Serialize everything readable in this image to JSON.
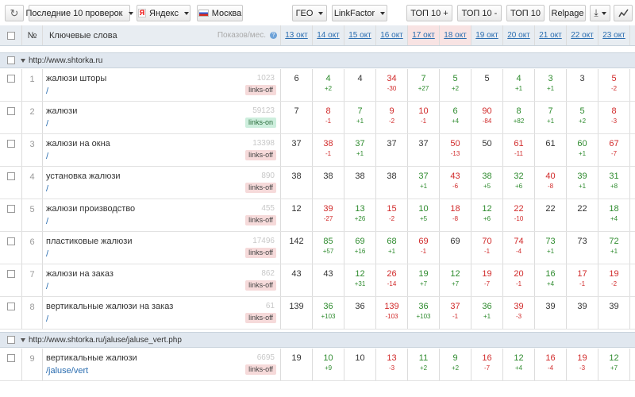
{
  "toolbar": {
    "history_label": "Последние 10 проверок",
    "engine_label": "Яндекс",
    "engine_logo": "Я",
    "region_label": "Москва",
    "geo_label": "ГЕО",
    "linkfactor_label": "LinkFactor",
    "top10plus_label": "ТОП 10 +",
    "top10minus_label": "ТОП 10 -",
    "top10_label": "ТОП 10",
    "relpage_label": "Relpage"
  },
  "table": {
    "col_num": "№",
    "col_keywords": "Ключевые слова",
    "col_shows": "Показов/мес.",
    "dates": [
      "13 окт",
      "14 окт",
      "15 окт",
      "16 окт",
      "17 окт",
      "18 окт",
      "19 окт",
      "20 окт",
      "21 окт",
      "22 окт",
      "23 окт"
    ],
    "highlight_dates": [
      4,
      5
    ]
  },
  "groups": [
    {
      "url": "http://www.shtorka.ru",
      "rows": [
        {
          "n": "1",
          "kw": "жалюзи шторы",
          "sub": "/",
          "shows": "1023",
          "tag": "links-off",
          "pos": [
            [
              "6",
              "",
              "flat"
            ],
            [
              "4",
              "+2",
              "up"
            ],
            [
              "4",
              "",
              "flat"
            ],
            [
              "34",
              "-30",
              "down"
            ],
            [
              "7",
              "+27",
              "up"
            ],
            [
              "5",
              "+2",
              "up"
            ],
            [
              "5",
              "",
              "flat"
            ],
            [
              "4",
              "+1",
              "up"
            ],
            [
              "3",
              "+1",
              "up"
            ],
            [
              "3",
              "",
              "flat"
            ],
            [
              "5",
              "-2",
              "down"
            ]
          ]
        },
        {
          "n": "2",
          "kw": "жалюзи",
          "sub": "/",
          "shows": "59123",
          "tag": "links-on",
          "pos": [
            [
              "7",
              "",
              "flat"
            ],
            [
              "8",
              "-1",
              "down"
            ],
            [
              "7",
              "+1",
              "up"
            ],
            [
              "9",
              "-2",
              "down"
            ],
            [
              "10",
              "-1",
              "down"
            ],
            [
              "6",
              "+4",
              "up"
            ],
            [
              "90",
              "-84",
              "down"
            ],
            [
              "8",
              "+82",
              "up"
            ],
            [
              "7",
              "+1",
              "up"
            ],
            [
              "5",
              "+2",
              "up"
            ],
            [
              "8",
              "-3",
              "down"
            ]
          ]
        },
        {
          "n": "3",
          "kw": "жалюзи на окна",
          "sub": "/",
          "shows": "13398",
          "tag": "links-off",
          "pos": [
            [
              "37",
              "",
              "flat"
            ],
            [
              "38",
              "-1",
              "down"
            ],
            [
              "37",
              "+1",
              "up"
            ],
            [
              "37",
              "",
              "flat"
            ],
            [
              "37",
              "",
              "flat"
            ],
            [
              "50",
              "-13",
              "down"
            ],
            [
              "50",
              "",
              "flat"
            ],
            [
              "61",
              "-11",
              "down"
            ],
            [
              "61",
              "",
              "flat"
            ],
            [
              "60",
              "+1",
              "up"
            ],
            [
              "67",
              "-7",
              "down"
            ]
          ]
        },
        {
          "n": "4",
          "kw": "установка жалюзи",
          "sub": "/",
          "shows": "890",
          "tag": "links-off",
          "pos": [
            [
              "38",
              "",
              "flat"
            ],
            [
              "38",
              "",
              "flat"
            ],
            [
              "38",
              "",
              "flat"
            ],
            [
              "38",
              "",
              "flat"
            ],
            [
              "37",
              "+1",
              "up"
            ],
            [
              "43",
              "-6",
              "down"
            ],
            [
              "38",
              "+5",
              "up"
            ],
            [
              "32",
              "+6",
              "up"
            ],
            [
              "40",
              "-8",
              "down"
            ],
            [
              "39",
              "+1",
              "up"
            ],
            [
              "31",
              "+8",
              "up"
            ]
          ]
        },
        {
          "n": "5",
          "kw": "жалюзи производство",
          "sub": "/",
          "shows": "455",
          "tag": "links-off",
          "pos": [
            [
              "12",
              "",
              "flat"
            ],
            [
              "39",
              "-27",
              "down"
            ],
            [
              "13",
              "+26",
              "up"
            ],
            [
              "15",
              "-2",
              "down"
            ],
            [
              "10",
              "+5",
              "up"
            ],
            [
              "18",
              "-8",
              "down"
            ],
            [
              "12",
              "+6",
              "up"
            ],
            [
              "22",
              "-10",
              "down"
            ],
            [
              "22",
              "",
              "flat"
            ],
            [
              "22",
              "",
              "flat"
            ],
            [
              "18",
              "+4",
              "up"
            ]
          ]
        },
        {
          "n": "6",
          "kw": "пластиковые жалюзи",
          "sub": "/",
          "shows": "17496",
          "tag": "links-off",
          "pos": [
            [
              "142",
              "",
              "flat"
            ],
            [
              "85",
              "+57",
              "up"
            ],
            [
              "69",
              "+16",
              "up"
            ],
            [
              "68",
              "+1",
              "up"
            ],
            [
              "69",
              "-1",
              "down"
            ],
            [
              "69",
              "",
              "flat"
            ],
            [
              "70",
              "-1",
              "down"
            ],
            [
              "74",
              "-4",
              "down"
            ],
            [
              "73",
              "+1",
              "up"
            ],
            [
              "73",
              "",
              "flat"
            ],
            [
              "72",
              "+1",
              "up"
            ]
          ]
        },
        {
          "n": "7",
          "kw": "жалюзи на заказ",
          "sub": "/",
          "shows": "862",
          "tag": "links-off",
          "pos": [
            [
              "43",
              "",
              "flat"
            ],
            [
              "43",
              "",
              "flat"
            ],
            [
              "12",
              "+31",
              "up"
            ],
            [
              "26",
              "-14",
              "down"
            ],
            [
              "19",
              "+7",
              "up"
            ],
            [
              "12",
              "+7",
              "up"
            ],
            [
              "19",
              "-7",
              "down"
            ],
            [
              "20",
              "-1",
              "down"
            ],
            [
              "16",
              "+4",
              "up"
            ],
            [
              "17",
              "-1",
              "down"
            ],
            [
              "19",
              "-2",
              "down"
            ]
          ]
        },
        {
          "n": "8",
          "kw": "вертикальные жалюзи на заказ",
          "sub": "/",
          "shows": "61",
          "tag": "links-off",
          "pos": [
            [
              "139",
              "",
              "flat"
            ],
            [
              "36",
              "+103",
              "up"
            ],
            [
              "36",
              "",
              "flat"
            ],
            [
              "139",
              "-103",
              "down"
            ],
            [
              "36",
              "+103",
              "up"
            ],
            [
              "37",
              "-1",
              "down"
            ],
            [
              "36",
              "+1",
              "up"
            ],
            [
              "39",
              "-3",
              "down"
            ],
            [
              "39",
              "",
              "flat"
            ],
            [
              "39",
              "",
              "flat"
            ],
            [
              "39",
              "",
              "flat"
            ]
          ]
        }
      ]
    },
    {
      "url": "http://www.shtorka.ru/jaluse/jaluse_vert.php",
      "rows": [
        {
          "n": "9",
          "kw": "вертикальные жалюзи",
          "sub": "/jaluse/vert",
          "shows": "6695",
          "tag": "links-off",
          "pos": [
            [
              "19",
              "",
              "flat"
            ],
            [
              "10",
              "+9",
              "up"
            ],
            [
              "10",
              "",
              "flat"
            ],
            [
              "13",
              "-3",
              "down"
            ],
            [
              "11",
              "+2",
              "up"
            ],
            [
              "9",
              "+2",
              "up"
            ],
            [
              "16",
              "-7",
              "down"
            ],
            [
              "12",
              "+4",
              "up"
            ],
            [
              "16",
              "-4",
              "down"
            ],
            [
              "19",
              "-3",
              "down"
            ],
            [
              "12",
              "+7",
              "up"
            ]
          ]
        }
      ]
    }
  ]
}
